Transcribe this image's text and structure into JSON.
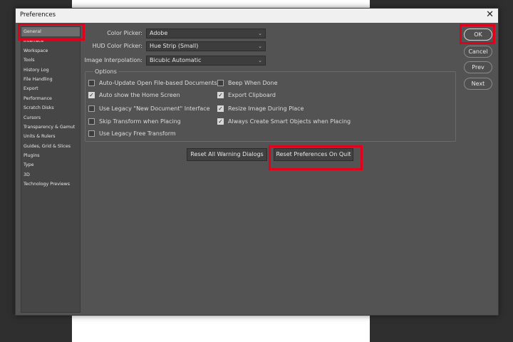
{
  "dialog": {
    "title": "Preferences",
    "close_glyph": "✕"
  },
  "sidebar": {
    "items": [
      {
        "label": "General",
        "selected": true
      },
      {
        "label": "Interface"
      },
      {
        "label": "Workspace"
      },
      {
        "label": "Tools"
      },
      {
        "label": "History Log"
      },
      {
        "label": "File Handling"
      },
      {
        "label": "Export"
      },
      {
        "label": "Performance"
      },
      {
        "label": "Scratch Disks"
      },
      {
        "label": "Cursors"
      },
      {
        "label": "Transparency & Gamut"
      },
      {
        "label": "Units & Rulers"
      },
      {
        "label": "Guides, Grid & Slices"
      },
      {
        "label": "Plugins"
      },
      {
        "label": "Type"
      },
      {
        "label": "3D"
      },
      {
        "label": "Technology Previews"
      }
    ]
  },
  "fields": {
    "color_picker": {
      "label": "Color Picker:",
      "value": "Adobe"
    },
    "hud_color_picker": {
      "label": "HUD Color Picker:",
      "value": "Hue Strip (Small)"
    },
    "image_interpolation": {
      "label": "Image Interpolation:",
      "value": "Bicubic Automatic"
    }
  },
  "options": {
    "legend": "Options",
    "items": [
      {
        "label": "Auto-Update Open File-based Documents",
        "checked": false
      },
      {
        "label": "Auto show the Home Screen",
        "checked": true
      },
      {
        "label": "Use Legacy \"New Document\" Interface",
        "checked": false
      },
      {
        "label": "Skip Transform when Placing",
        "checked": false
      },
      {
        "label": "Use Legacy Free Transform",
        "checked": false
      },
      {
        "label": "Beep When Done",
        "checked": false
      },
      {
        "label": "Export Clipboard",
        "checked": true
      },
      {
        "label": "Resize Image During Place",
        "checked": true
      },
      {
        "label": "Always Create Smart Objects when Placing",
        "checked": true
      }
    ]
  },
  "buttons": {
    "reset_warnings": "Reset All Warning Dialogs",
    "reset_prefs": "Reset Preferences On Quit",
    "ok": "OK",
    "cancel": "Cancel",
    "prev": "Prev",
    "next": "Next"
  },
  "colors": {
    "highlight": "#e3001b",
    "dialog_bg": "#535353"
  },
  "check_glyph": "✓"
}
